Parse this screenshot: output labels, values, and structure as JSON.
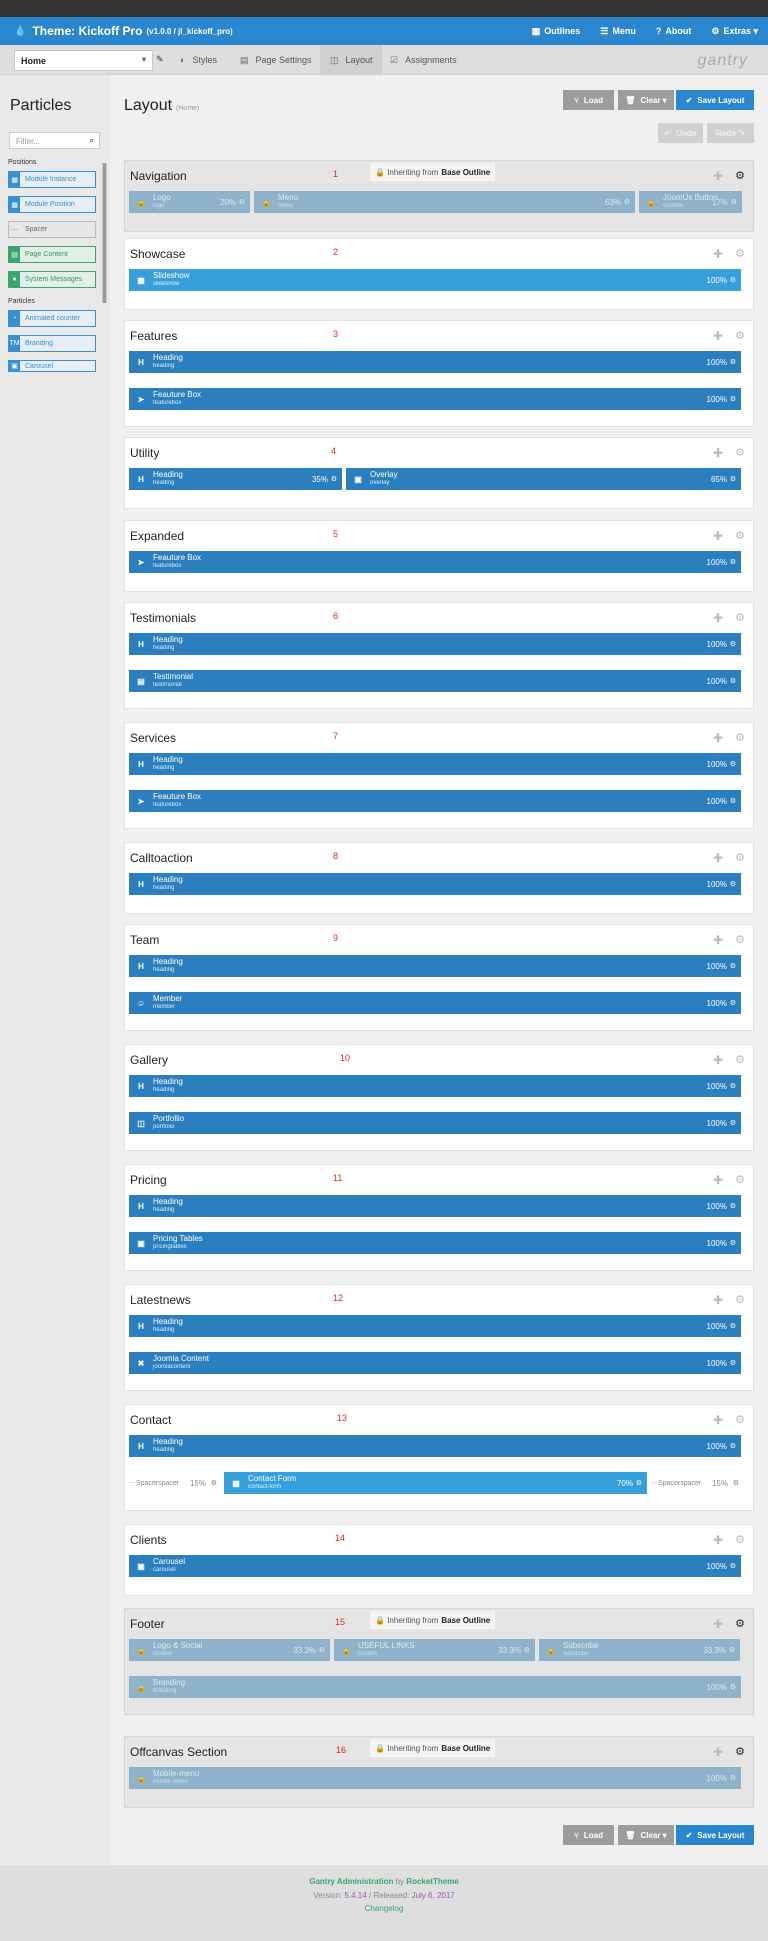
{
  "header": {
    "title": "Theme: Kickoff Pro",
    "version": "(v1.0.0 / jl_kickoff_pro)",
    "nav": [
      {
        "label": "Outlines",
        "icon": "th-icon"
      },
      {
        "label": "Menu",
        "icon": "bars-icon"
      },
      {
        "label": "About",
        "icon": "question-icon"
      },
      {
        "label": "Extras",
        "icon": "gear-icon"
      }
    ]
  },
  "subnav": {
    "outline": "Home",
    "tabs": [
      {
        "label": "Styles",
        "icon": "adjust-icon"
      },
      {
        "label": "Page Settings",
        "icon": "list-icon"
      },
      {
        "label": "Layout",
        "icon": "columns-icon"
      },
      {
        "label": "Assignments",
        "icon": "check-square-icon"
      }
    ],
    "logo": "gantry"
  },
  "sidebar": {
    "title": "Particles",
    "filter_placeholder": "Filter...",
    "positions_label": "Positions",
    "particles_label": "Particles",
    "positions": [
      {
        "label": "Module Instance",
        "style": "blue"
      },
      {
        "label": "Module Position",
        "style": "blue"
      },
      {
        "label": "Spacer",
        "style": "gray"
      },
      {
        "label": "Page Content",
        "style": "green"
      },
      {
        "label": "System Messages",
        "style": "green"
      }
    ],
    "particles": [
      {
        "label": "Animated counter"
      },
      {
        "label": "Branding"
      },
      {
        "label": "Carousel"
      }
    ]
  },
  "main": {
    "title": "Layout",
    "subtitle": "(Home)",
    "load": "Load",
    "clear": "Clear",
    "save": "Save Layout",
    "undo": "Undo",
    "redo": "Redo",
    "inheriting": "Inheriting from",
    "base_outline": "Base Outline",
    "sections": [
      {
        "title": "Navigation",
        "num": "1",
        "inherit": true,
        "rows": [
          [
            {
              "name": "Logo",
              "sub": "logo",
              "pct": "20%"
            },
            {
              "name": "Menu",
              "sub": "menu",
              "pct": "63%"
            },
            {
              "name": "JoomUs Button",
              "sub": "custom",
              "pct": "17%"
            }
          ]
        ]
      },
      {
        "title": "Showcase",
        "num": "2",
        "rows": [
          [
            {
              "name": "Slideshow",
              "sub": "slideshow",
              "pct": "100%"
            }
          ]
        ]
      },
      {
        "title": "Features",
        "num": "3",
        "rows": [
          [
            {
              "name": "Heading",
              "sub": "heading",
              "pct": "100%"
            }
          ],
          [
            {
              "name": "Feauture Box",
              "sub": "featurebox",
              "pct": "100%"
            }
          ]
        ]
      },
      {
        "title": "Utility",
        "num": "4",
        "rows": [
          [
            {
              "name": "Heading",
              "sub": "heading",
              "pct": "35%"
            },
            {
              "name": "Overlay",
              "sub": "overlay",
              "pct": "65%"
            }
          ]
        ]
      },
      {
        "title": "Expanded",
        "num": "5",
        "rows": [
          [
            {
              "name": "Feauture Box",
              "sub": "featurebox",
              "pct": "100%"
            }
          ]
        ]
      },
      {
        "title": "Testimonials",
        "num": "6",
        "rows": [
          [
            {
              "name": "Heading",
              "sub": "heading",
              "pct": "100%"
            }
          ],
          [
            {
              "name": "Testimonial",
              "sub": "testimonial",
              "pct": "100%"
            }
          ]
        ]
      },
      {
        "title": "Services",
        "num": "7",
        "rows": [
          [
            {
              "name": "Heading",
              "sub": "heading",
              "pct": "100%"
            }
          ],
          [
            {
              "name": "Feauture Box",
              "sub": "featurebox",
              "pct": "100%"
            }
          ]
        ]
      },
      {
        "title": "Calltoaction",
        "num": "8",
        "rows": [
          [
            {
              "name": "Heading",
              "sub": "heading",
              "pct": "100%"
            }
          ]
        ]
      },
      {
        "title": "Team",
        "num": "9",
        "rows": [
          [
            {
              "name": "Heading",
              "sub": "heading",
              "pct": "100%"
            }
          ],
          [
            {
              "name": "Member",
              "sub": "member",
              "pct": "100%"
            }
          ]
        ]
      },
      {
        "title": "Gallery",
        "num": "10",
        "rows": [
          [
            {
              "name": "Heading",
              "sub": "heading",
              "pct": "100%"
            }
          ],
          [
            {
              "name": "Portfollio",
              "sub": "portfolio",
              "pct": "100%"
            }
          ]
        ]
      },
      {
        "title": "Pricing",
        "num": "11",
        "rows": [
          [
            {
              "name": "Heading",
              "sub": "heading",
              "pct": "100%"
            }
          ],
          [
            {
              "name": "Pricing Tables",
              "sub": "pricingtables",
              "pct": "100%"
            }
          ]
        ]
      },
      {
        "title": "Latestnews",
        "num": "12",
        "rows": [
          [
            {
              "name": "Heading",
              "sub": "heading",
              "pct": "100%"
            }
          ],
          [
            {
              "name": "Joomla Content",
              "sub": "joomlacontent",
              "pct": "100%"
            }
          ]
        ]
      },
      {
        "title": "Contact",
        "num": "13",
        "rows": [
          [
            {
              "name": "Heading",
              "sub": "heading",
              "pct": "100%"
            }
          ],
          [
            {
              "name": "Spacer",
              "sub": "spacer",
              "pct": "15%",
              "kind": "spacer"
            },
            {
              "name": "Contact Form",
              "sub": "contact-form",
              "pct": "70%"
            },
            {
              "name": "Spacer",
              "sub": "spacer",
              "pct": "15%",
              "kind": "spacer"
            }
          ]
        ]
      },
      {
        "title": "Clients",
        "num": "14",
        "rows": [
          [
            {
              "name": "Carousel",
              "sub": "carousel",
              "pct": "100%"
            }
          ]
        ]
      },
      {
        "title": "Footer",
        "num": "15",
        "inherit": true,
        "rows": [
          [
            {
              "name": "Logo & Social",
              "sub": "custom",
              "pct": "33.3%"
            },
            {
              "name": "USEFUL LINKS",
              "sub": "custom",
              "pct": "33.3%"
            },
            {
              "name": "Subscribe",
              "sub": "subscribe",
              "pct": "33.3%"
            }
          ],
          [
            {
              "name": "Branding",
              "sub": "branding",
              "pct": "100%"
            }
          ]
        ]
      },
      {
        "title": "Offcanvas Section",
        "num": "16",
        "inherit": true,
        "rows": [
          [
            {
              "name": "Mobile-menu",
              "sub": "mobile-menu",
              "pct": "100%"
            }
          ]
        ]
      }
    ]
  },
  "footer": {
    "admin": "Gantry Administration",
    "by": "by",
    "company": "RocketTheme",
    "version_label": "Version:",
    "version": "5.4.14",
    "released_label": "/ Released:",
    "released": "July 6, 2017",
    "changelog": "Changelog"
  },
  "colors": {
    "accent": "#2a87cf",
    "block": "#2b7fbf",
    "annotation": "#e2231a"
  }
}
